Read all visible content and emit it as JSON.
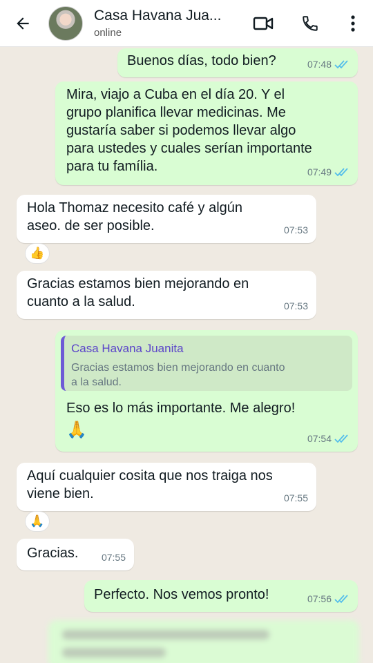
{
  "header": {
    "contact_name": "Casa Havana Jua...",
    "status": "online"
  },
  "colors": {
    "outgoing_bubble": "#d9fdd3",
    "incoming_bubble": "#ffffff",
    "read_ticks": "#53bdeb",
    "quote_accent": "#6e5bd6"
  },
  "messages": [
    {
      "dir": "out",
      "text": "Buenos días, todo bien?",
      "time": "07:48",
      "read": true
    },
    {
      "dir": "out",
      "text": "Mira, viajo a Cuba en el día 20. Y el\ngrupo planifica llevar medicinas. Me\ngustaría saber si podemos llevar algo\npara ustedes y cuales serían importante\npara tu família.",
      "time": "07:49",
      "read": true
    },
    {
      "dir": "in",
      "text": "Hola Thomaz necesito café y algún\naseo. de ser posible.",
      "time": "07:53",
      "reaction": "👍"
    },
    {
      "dir": "in",
      "text": "Gracias estamos bien mejorando  en\ncuanto a la salud.",
      "time": "07:53"
    },
    {
      "dir": "out",
      "quote_name": "Casa Havana Juanita",
      "quote_text": "Gracias estamos bien mejorando  en cuanto\na la salud.",
      "text": "Eso es lo más importante. Me alegro!",
      "emoji": "🙏",
      "time": "07:54",
      "read": true
    },
    {
      "dir": "in",
      "text": "Aquí cualquier cosita que nos traiga nos\nviene bien.",
      "time": "07:55",
      "reaction": "🙏"
    },
    {
      "dir": "in",
      "text": "Gracias.",
      "time": "07:55"
    },
    {
      "dir": "out",
      "text": "Perfecto. Nos vemos pronto!",
      "time": "07:56",
      "read": true
    }
  ]
}
